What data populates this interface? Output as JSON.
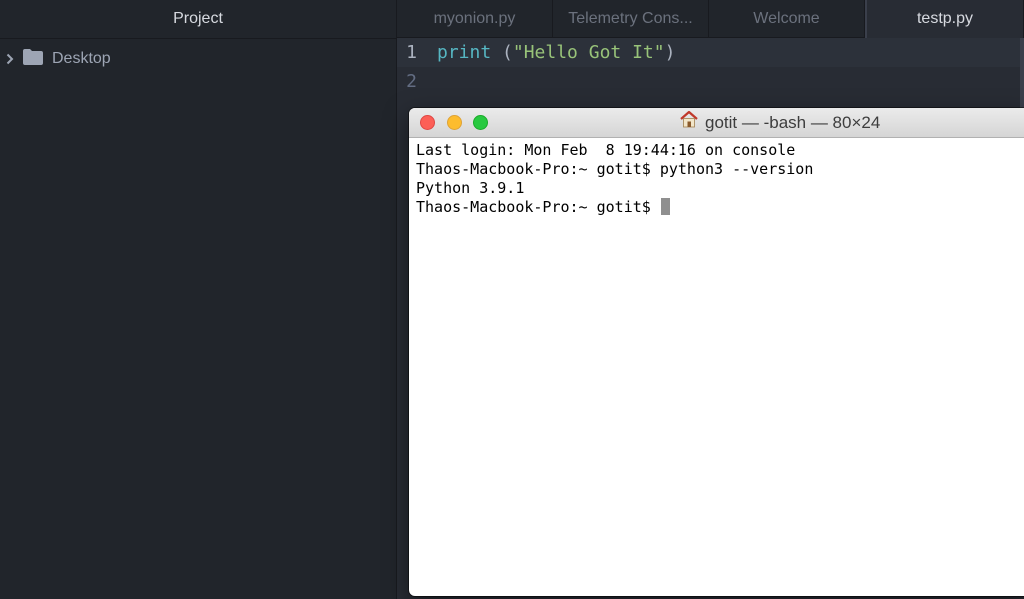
{
  "sidebar": {
    "title": "Project",
    "items": [
      {
        "label": "Desktop",
        "icon": "folder-icon",
        "expanded": false
      }
    ]
  },
  "tabs": [
    {
      "label": "myonion.py",
      "active": false
    },
    {
      "label": "Telemetry Cons...",
      "active": false
    },
    {
      "label": "Welcome",
      "active": false
    },
    {
      "label": "testp.py",
      "active": true
    }
  ],
  "editor": {
    "lines": [
      {
        "number": "1",
        "fn": "print",
        "open": " (",
        "str": "\"Hello Got It\"",
        "close": ")"
      },
      {
        "number": "2",
        "text": ""
      }
    ]
  },
  "terminal": {
    "title": "gotit — -bash — 80×24",
    "lines": [
      "Last login: Mon Feb  8 19:44:16 on console",
      "Thaos-Macbook-Pro:~ gotit$ python3 --version",
      "Python 3.9.1",
      "Thaos-Macbook-Pro:~ gotit$ "
    ]
  },
  "colors": {
    "background": "#21252b",
    "editor_bg": "#282c34",
    "fn": "#56b6c2",
    "string": "#98c379",
    "traffic_red": "#fc5f57",
    "traffic_yellow": "#fdbc2e",
    "traffic_green": "#28c940"
  }
}
